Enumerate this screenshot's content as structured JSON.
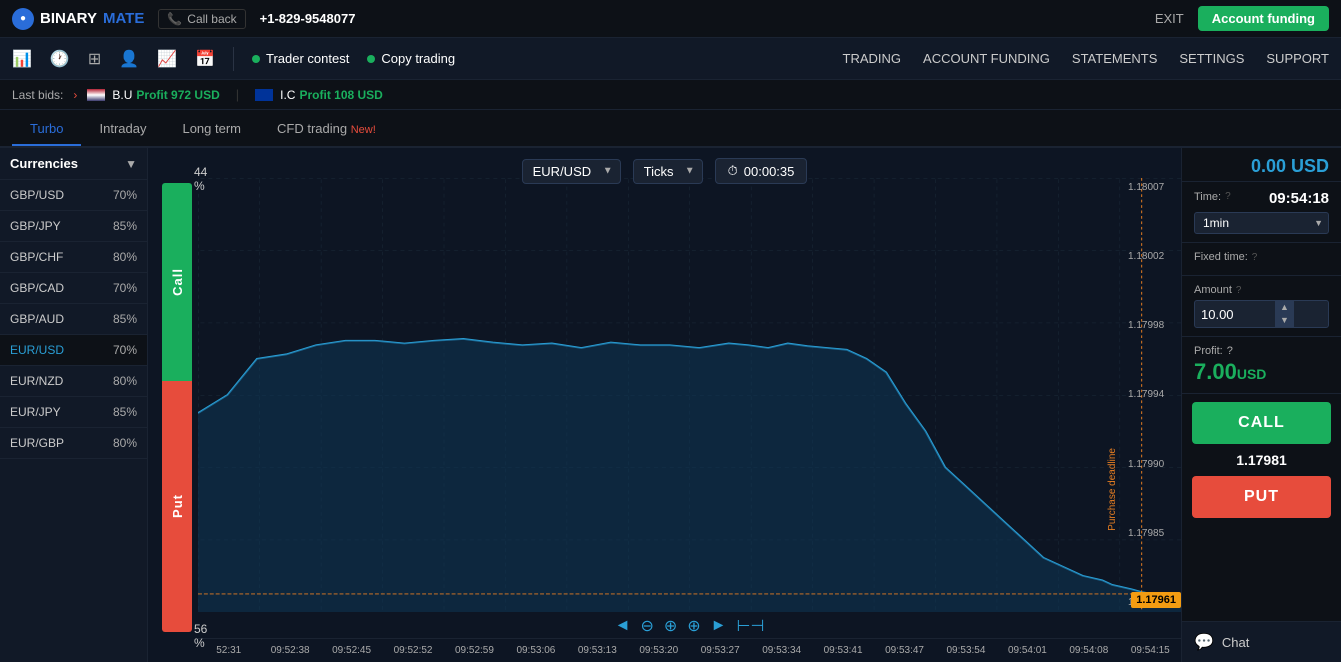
{
  "topnav": {
    "logo_binary": "BINARY",
    "logo_mate": "MATE",
    "callback_label": "Call back",
    "phone": "+1-829-9548077",
    "exit_label": "EXIT",
    "account_funding_label": "Account funding"
  },
  "iconbar": {
    "trader_contest": "Trader contest",
    "copy_trading": "Copy trading",
    "nav_links": [
      "TRADING",
      "ACCOUNT FUNDING",
      "STATEMENTS",
      "SETTINGS",
      "SUPPORT"
    ]
  },
  "lastbids": {
    "label": "Last bids:",
    "entry1_code": "B.U",
    "entry1_profit": "Profit 972 USD",
    "entry2_code": "I.C",
    "entry2_profit": "Profit 108 USD"
  },
  "tabs": [
    {
      "id": "turbo",
      "label": "Turbo",
      "active": true
    },
    {
      "id": "intraday",
      "label": "Intraday",
      "active": false
    },
    {
      "id": "longterm",
      "label": "Long term",
      "active": false
    },
    {
      "id": "cfd",
      "label": "CFD trading New!",
      "active": false
    }
  ],
  "sidebar": {
    "header": "Currencies",
    "items": [
      {
        "name": "GBP/USD",
        "pct": "70%"
      },
      {
        "name": "GBP/JPY",
        "pct": "85%"
      },
      {
        "name": "GBP/CHF",
        "pct": "80%"
      },
      {
        "name": "GBP/CAD",
        "pct": "70%"
      },
      {
        "name": "GBP/AUD",
        "pct": "85%"
      },
      {
        "name": "EUR/USD",
        "pct": "70%",
        "active": true
      },
      {
        "name": "EUR/NZD",
        "pct": "80%"
      },
      {
        "name": "EUR/JPY",
        "pct": "85%"
      },
      {
        "name": "EUR/GBP",
        "pct": "80%"
      }
    ]
  },
  "chart": {
    "currency_pair": "EUR/USD",
    "ticks_label": "Ticks",
    "timer": "00:00:35",
    "call_pct": "44 %",
    "put_pct": "56 %",
    "call_label": "Call",
    "put_label": "Put",
    "y_labels": [
      "1.18007",
      "1.18002",
      "1.17998",
      "1.17994",
      "1.17990",
      "1.17985",
      "1.17961"
    ],
    "x_labels": [
      "52:31",
      "09:52:38",
      "09:52:45",
      "09:52:52",
      "09:52:59",
      "09:53:06",
      "09:53:13",
      "09:53:20",
      "09:53:27",
      "09:53:34",
      "09:53:41",
      "09:53:47",
      "09:53:54",
      "09:54:01",
      "09:54:08",
      "09:54:15"
    ],
    "purchase_deadline": "Purchase deadline",
    "price_tag": "1.17961",
    "nav_btns": [
      "◄",
      "⊖",
      "⊕",
      "↔",
      "►",
      "⊢⊣"
    ]
  },
  "rightpanel": {
    "balance": "0.00 USD",
    "time_label": "Time:",
    "time_help": "?",
    "time_value": "09:54:18",
    "time_select": "1min",
    "fixed_time_label": "Fixed time:",
    "fixed_time_help": "?",
    "amount_label": "Amount",
    "amount_help": "?",
    "amount_value": "10.00",
    "profit_label": "Profit:",
    "profit_help": "?",
    "profit_value": "7.00",
    "profit_currency": "USD",
    "call_btn": "CALL",
    "price_display": "1.17981",
    "put_btn": "PUT",
    "chat_label": "Chat"
  }
}
